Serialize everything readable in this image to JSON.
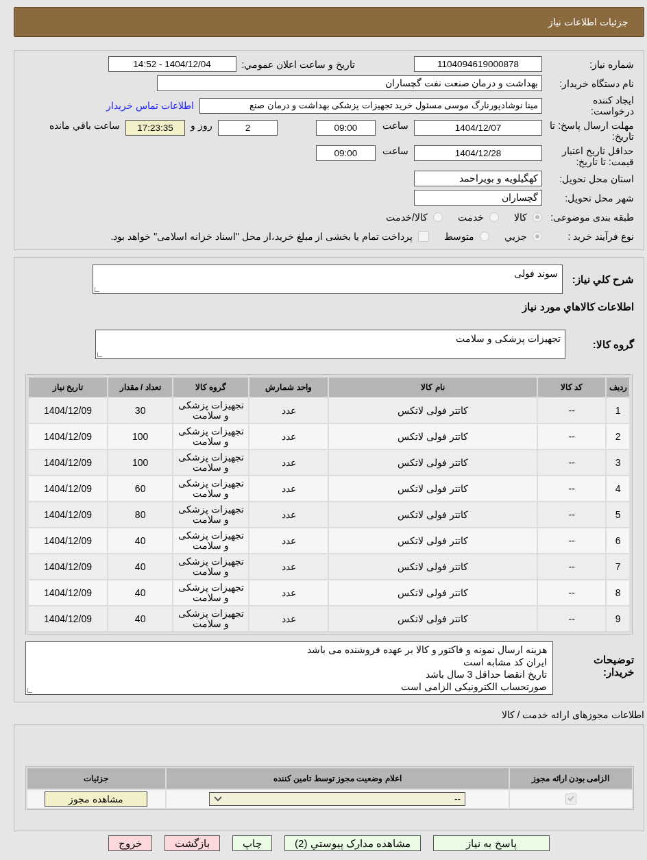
{
  "header": {
    "title": "جزئیات اطلاعات نیاز"
  },
  "info": {
    "need_number": {
      "label": "شماره نیاز:",
      "value": "1104094619000878"
    },
    "announce": {
      "label": "تاریخ و ساعت اعلان عمومي:",
      "value": "1404/12/04 - 14:52"
    },
    "buyer": {
      "label": "نام دستگاه خریدار:",
      "value": "بهداشت و درمان صنعت نفت گچساران"
    },
    "requester": {
      "label": "ایجاد کننده درخواست:",
      "value": "مینا نوشادپورنارگ موسی مسئول خرید تجهیزات پزشکی  بهداشت و درمان صنع",
      "link": "اطلاعات تماس خریدار"
    },
    "deadline": {
      "label": "مهلت ارسال پاسخ: تا تاریخ:",
      "date": "1404/12/07",
      "time_label": "ساعت",
      "time": "09:00",
      "days": "2",
      "days_label": "روز و",
      "remaining": "17:23:35",
      "remaining_label": "ساعت باقي مانده"
    },
    "validity": {
      "label": "حداقل تاریخ اعتبار قیمت: تا تاریخ:",
      "date": "1404/12/28",
      "time_label": "ساعت",
      "time": "09:00"
    },
    "province": {
      "label": "استان محل تحویل:",
      "value": "کهگیلویه و بویراحمد"
    },
    "city": {
      "label": "شهر محل تحویل:",
      "value": "گچساران"
    },
    "category": {
      "label": "طبقه بندی موضوعی:",
      "options": [
        {
          "label": "کالا",
          "selected": true
        },
        {
          "label": "خدمت",
          "selected": false
        },
        {
          "label": "کالا/خدمت",
          "selected": false
        }
      ]
    },
    "process": {
      "label": "نوع فرآیند خرید :",
      "options": [
        {
          "label": "جزيي",
          "selected": true
        },
        {
          "label": "متوسط",
          "selected": false
        }
      ],
      "payment": {
        "label": "پرداخت تمام یا بخشی از مبلغ خرید،از محل \"اسناد خزانه اسلامی\" خواهد بود.",
        "checked": false
      }
    }
  },
  "details": {
    "description": {
      "label": "شرح کلي نیاز:",
      "value": "سوند فولی"
    },
    "items_title": "اطلاعات کالاهاي مورد نیاز",
    "group": {
      "label": "گروه کالا:",
      "value": "تجهیزات پزشکی و سلامت"
    },
    "table": {
      "columns": [
        "ردیف",
        "کد کالا",
        "نام کالا",
        "واحد شمارش",
        "گروه کالا",
        "تعداد / مقدار",
        "تاریخ نیاز"
      ],
      "rows": [
        [
          "1",
          "--",
          "کاتتر فولی لاتکس",
          "عدد",
          "تجهیزات پزشکی و سلامت",
          "30",
          "1404/12/09"
        ],
        [
          "2",
          "--",
          "کاتتر فولی لاتکس",
          "عدد",
          "تجهیزات پزشکی و سلامت",
          "100",
          "1404/12/09"
        ],
        [
          "3",
          "--",
          "کاتتر فولی لاتکس",
          "عدد",
          "تجهیزات پزشکی و سلامت",
          "100",
          "1404/12/09"
        ],
        [
          "4",
          "--",
          "کاتتر فولی لاتکس",
          "عدد",
          "تجهیزات پزشکی و سلامت",
          "60",
          "1404/12/09"
        ],
        [
          "5",
          "--",
          "کاتتر فولی لاتکس",
          "عدد",
          "تجهیزات پزشکی و سلامت",
          "80",
          "1404/12/09"
        ],
        [
          "6",
          "--",
          "کاتتر فولی لاتکس",
          "عدد",
          "تجهیزات پزشکی و سلامت",
          "40",
          "1404/12/09"
        ],
        [
          "7",
          "--",
          "کاتتر فولی لاتکس",
          "عدد",
          "تجهیزات پزشکی و سلامت",
          "40",
          "1404/12/09"
        ],
        [
          "8",
          "--",
          "کاتتر فولی لاتکس",
          "عدد",
          "تجهیزات پزشکی و سلامت",
          "40",
          "1404/12/09"
        ],
        [
          "9",
          "--",
          "کاتتر فولی لاتکس",
          "عدد",
          "تجهیزات پزشکی و سلامت",
          "40",
          "1404/12/09"
        ]
      ]
    },
    "notes": {
      "label": "توضیحات خریدار:",
      "lines": [
        "هزینه ارسال نمونه و فاکتور و کالا بر عهده فروشنده می باشد",
        "ایران کد مشابه است",
        "تاریخ انقضا حداقل 3 سال باشد",
        "صورتحساب الکترونیکی الزامی است"
      ]
    }
  },
  "licenses": {
    "title": "اطلاعات مجوزهای ارائه خدمت / کالا",
    "columns": [
      "الزامی بودن ارائه مجوز",
      "اعلام وضعیت مجوز توسط تامین کننده",
      "جزئیات"
    ],
    "rows": [
      {
        "required": true,
        "status": "--",
        "button": "مشاهده مجوز"
      }
    ]
  },
  "buttons": [
    {
      "label": "پاسخ به نیاز",
      "kind": "normal"
    },
    {
      "label": "مشاهده مدارک پیوستي (2)",
      "kind": "normal"
    },
    {
      "label": "چاپ",
      "kind": "normal"
    },
    {
      "label": "بازگشت",
      "kind": "danger"
    },
    {
      "label": "خروج",
      "kind": "danger"
    }
  ]
}
